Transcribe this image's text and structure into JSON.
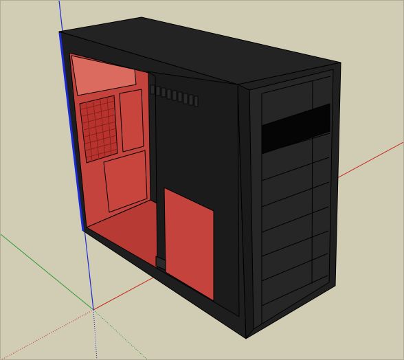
{
  "canvas": {
    "background": "#d1ccb4",
    "axis_colors": {
      "red_axis": "#c8281e",
      "green_axis": "#1e9a2a",
      "blue_axis": "#1a2ad8"
    }
  },
  "model": {
    "object": "pc-tower-case",
    "case_color": "#1b1b1b",
    "edge_color": "#000000",
    "interior_color": "#c4423c",
    "interior_highlight": "#dc6a5e",
    "drive_slot_color": "#050505"
  }
}
